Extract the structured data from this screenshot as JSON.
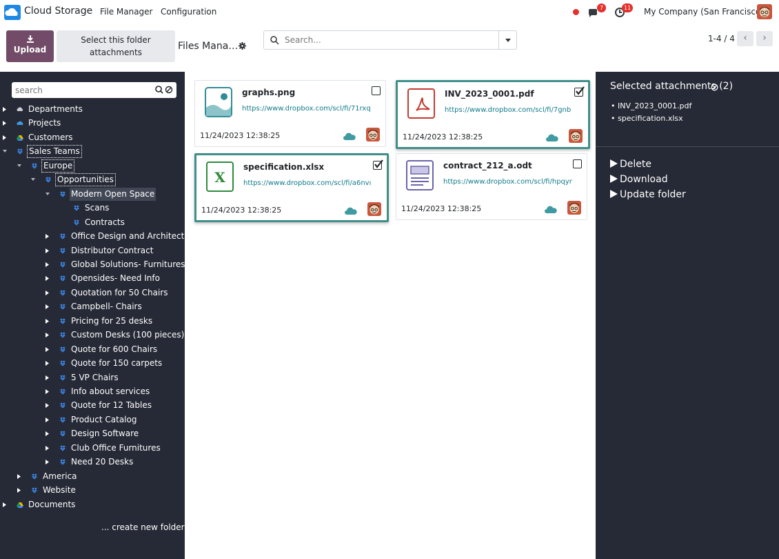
{
  "navbar": {
    "app_title": "Cloud Storage",
    "menu": [
      "File Manager",
      "Configuration"
    ],
    "messages_badge": "7",
    "activities_badge": "11",
    "company": "My Company (San Francisco)"
  },
  "control_panel": {
    "upload_label": "Upload",
    "select_folder_label": "Select this folder attachments",
    "breadcrumb": "Files Mana…",
    "search_placeholder": "Search...",
    "pager": "1-4 / 4"
  },
  "sidebar": {
    "search_placeholder": "search",
    "create_folder": "... create new folder",
    "items": [
      {
        "label": "Departments",
        "level": 0,
        "expanded": false,
        "icon": "cloud-icon"
      },
      {
        "label": "Projects",
        "level": 0,
        "expanded": false,
        "icon": "onedrive-icon"
      },
      {
        "label": "Customers",
        "level": 0,
        "expanded": false,
        "icon": "google-drive-icon"
      },
      {
        "label": "Sales Teams",
        "level": 0,
        "expanded": true,
        "icon": "dropbox-icon"
      },
      {
        "label": "Europe",
        "level": 1,
        "expanded": true,
        "icon": "dropbox-icon"
      },
      {
        "label": "Opportunities",
        "level": 2,
        "expanded": true,
        "icon": "dropbox-icon"
      },
      {
        "label": "Modern Open Space",
        "level": 3,
        "expanded": true,
        "icon": "dropbox-icon",
        "selected": true
      },
      {
        "label": "Scans",
        "level": 4,
        "icon": "dropbox-icon"
      },
      {
        "label": "Contracts",
        "level": 4,
        "icon": "dropbox-icon"
      },
      {
        "label": "Office Design and Architecture",
        "level": 3,
        "expanded": false,
        "icon": "dropbox-icon"
      },
      {
        "label": "Distributor Contract",
        "level": 3,
        "expanded": false,
        "icon": "dropbox-icon"
      },
      {
        "label": "Global Solutions- Furnitures",
        "level": 3,
        "expanded": false,
        "icon": "dropbox-icon"
      },
      {
        "label": "Opensides- Need Info",
        "level": 3,
        "expanded": false,
        "icon": "dropbox-icon"
      },
      {
        "label": "Quotation for 50 Chairs",
        "level": 3,
        "expanded": false,
        "icon": "dropbox-icon"
      },
      {
        "label": "Campbell- Chairs",
        "level": 3,
        "expanded": false,
        "icon": "dropbox-icon"
      },
      {
        "label": "Pricing for 25 desks",
        "level": 3,
        "expanded": false,
        "icon": "dropbox-icon"
      },
      {
        "label": "Custom Desks (100 pieces)",
        "level": 3,
        "expanded": false,
        "icon": "dropbox-icon"
      },
      {
        "label": "Quote for 600 Chairs",
        "level": 3,
        "expanded": false,
        "icon": "dropbox-icon"
      },
      {
        "label": "Quote for 150 carpets",
        "level": 3,
        "expanded": false,
        "icon": "dropbox-icon"
      },
      {
        "label": "5 VP Chairs",
        "level": 3,
        "expanded": false,
        "icon": "dropbox-icon"
      },
      {
        "label": "Info about services",
        "level": 3,
        "expanded": false,
        "icon": "dropbox-icon"
      },
      {
        "label": "Quote for 12 Tables",
        "level": 3,
        "expanded": false,
        "icon": "dropbox-icon"
      },
      {
        "label": "Product Catalog",
        "level": 3,
        "expanded": false,
        "icon": "dropbox-icon"
      },
      {
        "label": "Design Software",
        "level": 3,
        "expanded": false,
        "icon": "dropbox-icon"
      },
      {
        "label": "Club Office Furnitures",
        "level": 3,
        "expanded": false,
        "icon": "dropbox-icon"
      },
      {
        "label": "Need 20 Desks",
        "level": 3,
        "expanded": false,
        "icon": "dropbox-icon"
      },
      {
        "label": "America",
        "level": 1,
        "expanded": false,
        "icon": "dropbox-icon"
      },
      {
        "label": "Website",
        "level": 1,
        "expanded": false,
        "icon": "dropbox-icon"
      },
      {
        "label": "Documents",
        "level": 0,
        "expanded": false,
        "icon": "google-drive-icon"
      }
    ]
  },
  "files": [
    {
      "name": "graphs.png",
      "url": "https://www.dropbox.com/scl/fi/71rxq",
      "date": "11/24/2023 12:38:25",
      "checked": false,
      "type": "image-file-icon"
    },
    {
      "name": "INV_2023_0001.pdf",
      "url": "https://www.dropbox.com/scl/fi/7gnb",
      "date": "11/24/2023 12:38:25",
      "checked": true,
      "type": "pdf-file-icon"
    },
    {
      "name": "specification.xlsx",
      "url": "https://www.dropbox.com/scl/fi/a6nvı",
      "date": "11/24/2023 12:38:25",
      "checked": true,
      "type": "spreadsheet-file-icon"
    },
    {
      "name": "contract_212_a.odt",
      "url": "https://www.dropbox.com/scl/fi/hpqyr",
      "date": "11/24/2023 12:38:25",
      "checked": false,
      "type": "document-file-icon"
    }
  ],
  "selection_panel": {
    "title": "Selected attachments (2)",
    "selected": [
      "INV_2023_0001.pdf",
      "specification.xlsx"
    ],
    "actions": [
      "Delete",
      "Download",
      "Update folder"
    ]
  },
  "colors": {
    "brand": "#714b67",
    "sidebar_bg": "#262a36",
    "checked_border": "#3f8e8a",
    "link": "#107a8a",
    "badge": "#e4312b"
  }
}
